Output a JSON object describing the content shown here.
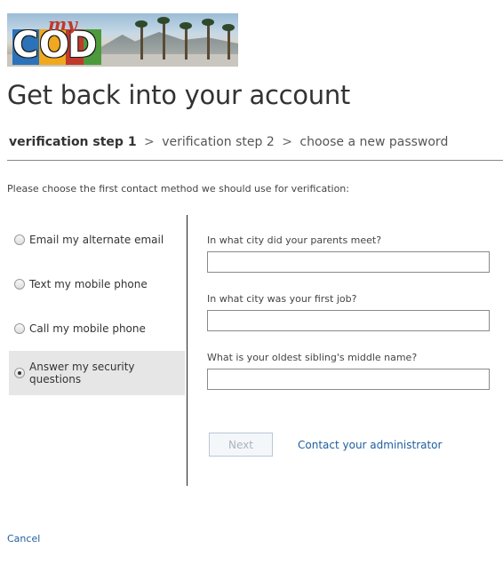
{
  "banner": {
    "logo_text": "COD",
    "logo_prefix": "my",
    "logo_colors": [
      "#2c72b8",
      "#f0a81e",
      "#c0392b",
      "#4c9a3c"
    ]
  },
  "page": {
    "title": "Get back into your account"
  },
  "steps": {
    "step1": "verification step 1",
    "step2": "verification step 2",
    "step3": "choose a new password",
    "separator": ">"
  },
  "prompt": "Please choose the first contact method we should use for verification:",
  "methods": [
    {
      "label": "Email my alternate email",
      "selected": false
    },
    {
      "label": "Text my mobile phone",
      "selected": false
    },
    {
      "label": "Call my mobile phone",
      "selected": false
    },
    {
      "label": "Answer my security questions",
      "selected": true
    }
  ],
  "questions": [
    {
      "label": "In what city did your parents meet?",
      "value": ""
    },
    {
      "label": "In what city was your first job?",
      "value": ""
    },
    {
      "label": "What is your oldest sibling's middle name?",
      "value": ""
    }
  ],
  "actions": {
    "next_label": "Next",
    "contact_label": "Contact your administrator",
    "cancel_label": "Cancel"
  },
  "colors": {
    "link": "#1f5fa0",
    "selected_bg": "#e6e6e6"
  }
}
